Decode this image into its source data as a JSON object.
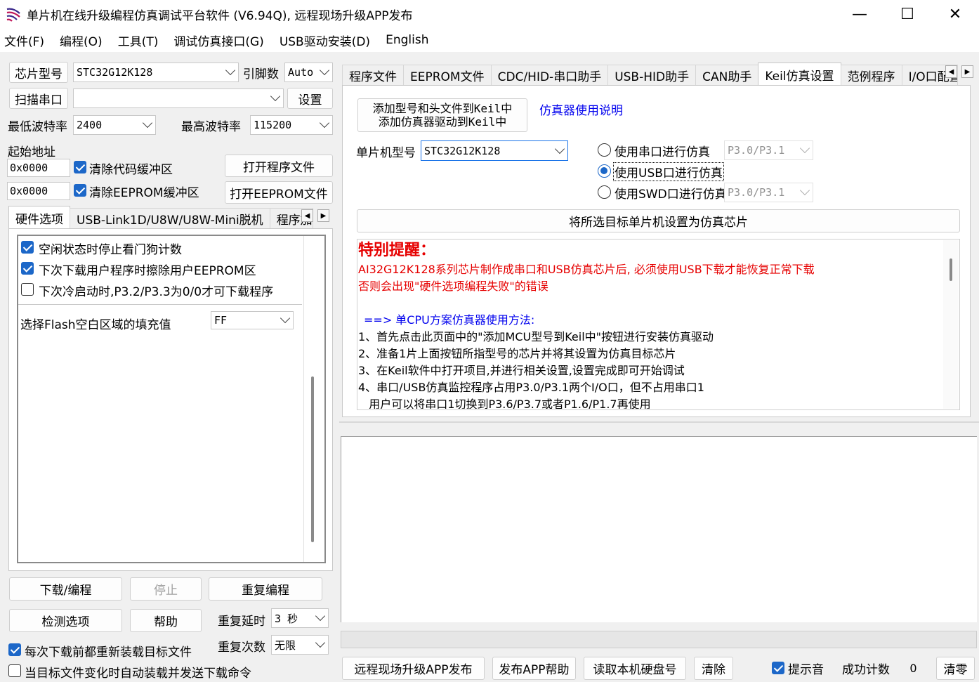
{
  "window": {
    "title": "单片机在线升级编程仿真调试平台软件 (V6.94Q), 远程现场升级APP发布",
    "controls": {
      "minimize": "—",
      "maximize": "☐",
      "close": "✕"
    }
  },
  "menu": [
    "文件(F)",
    "编程(O)",
    "工具(T)",
    "调试仿真接口(G)",
    "USB驱动安装(D)",
    "English"
  ],
  "left": {
    "chip_model_btn": "芯片型号",
    "chip_model_value": "STC32G12K128",
    "pin_label": "引脚数",
    "pin_value": "Auto",
    "scan_port_btn": "扫描串口",
    "port_value": "",
    "settings_btn": "设置",
    "min_baud_label": "最低波特率",
    "min_baud_value": "2400",
    "max_baud_label": "最高波特率",
    "max_baud_value": "115200",
    "start_addr_label": "起始地址",
    "code_addr": "0x0000",
    "clear_code_buf": "清除代码缓冲区",
    "open_program_btn": "打开程序文件",
    "eeprom_addr": "0x0000",
    "clear_eeprom_buf": "清除EEPROM缓冲区",
    "open_eeprom_btn": "打开EEPROM文件",
    "tabs": [
      "硬件选项",
      "USB-Link1D/U8W/U8W-Mini脱机",
      "程序加"
    ],
    "options": [
      {
        "label": "空闲状态时停止看门狗计数",
        "checked": true
      },
      {
        "label": "下次下载用户程序时擦除用户EEPROM区",
        "checked": true
      },
      {
        "label": "下次冷启动时,P3.2/P3.3为0/0才可下载程序",
        "checked": false
      }
    ],
    "fill_label": "选择Flash空白区域的填充值",
    "fill_value": "FF",
    "download_btn": "下载/编程",
    "stop_btn": "停止",
    "reprogram_btn": "重复编程",
    "check_btn": "检测选项",
    "help_btn": "帮助",
    "repeat_delay_label": "重复延时",
    "repeat_delay_value": "3 秒",
    "repeat_count_label": "重复次数",
    "repeat_count_value": "无限",
    "reload_before_download": "每次下载前都重新装载目标文件",
    "auto_reload_on_change": "当目标文件变化时自动装载并发送下载命令"
  },
  "right": {
    "tabs": [
      "程序文件",
      "EEPROM文件",
      "CDC/HID-串口助手",
      "USB-HID助手",
      "CAN助手",
      "Keil仿真设置",
      "范例程序",
      "I/O口配置"
    ],
    "add_keil_btn_line1": "添加型号和头文件到Keil中",
    "add_keil_btn_line2": "添加仿真器驱动到Keil中",
    "emulator_help_link": "仿真器使用说明",
    "mcu_model_label": "单片机型号",
    "mcu_model_value": "STC32G12K128",
    "radio_serial": "使用串口进行仿真",
    "radio_serial_port": "P3.0/P3.1",
    "radio_usb": "使用USB口进行仿真",
    "radio_swd": "使用SWD口进行仿真",
    "radio_swd_port": "P3.0/P3.1",
    "set_target_btn": "将所选目标单片机设置为仿真芯片",
    "notes": {
      "heading": "特别提醒：",
      "warn1": "AI32G12K128系列芯片制作成串口和USB仿真芯片后, 必须使用USB下载才能恢复正常下载",
      "warn2": "否则会出现\"硬件选项编程失败\"的错误",
      "section": "==> 单CPU方案仿真器使用方法:",
      "steps": [
        "1、首先点击此页面中的\"添加MCU型号到Keil中\"按钮进行安装仿真驱动",
        "2、准备1片上面按钮所指型号的芯片并将其设置为仿真目标芯片",
        "3、在Keil软件中打开项目,并进行相关设置,设置完成即可开始调试",
        "4、串口/USB仿真监控程序占用P3.0/P3.1两个I/O口，但不占用串口1",
        "   用户可以将串口1切换到P3.6/P3.7或者P1.6/P1.7再使用"
      ]
    }
  },
  "bottom": {
    "remote_publish_btn": "远程现场升级APP发布",
    "publish_help_btn": "发布APP帮助",
    "read_disk_btn": "读取本机硬盘号",
    "clear_btn": "清除",
    "beep_label": "提示音",
    "success_count_label": "成功计数",
    "success_count_value": "0",
    "reset_btn": "清零"
  }
}
